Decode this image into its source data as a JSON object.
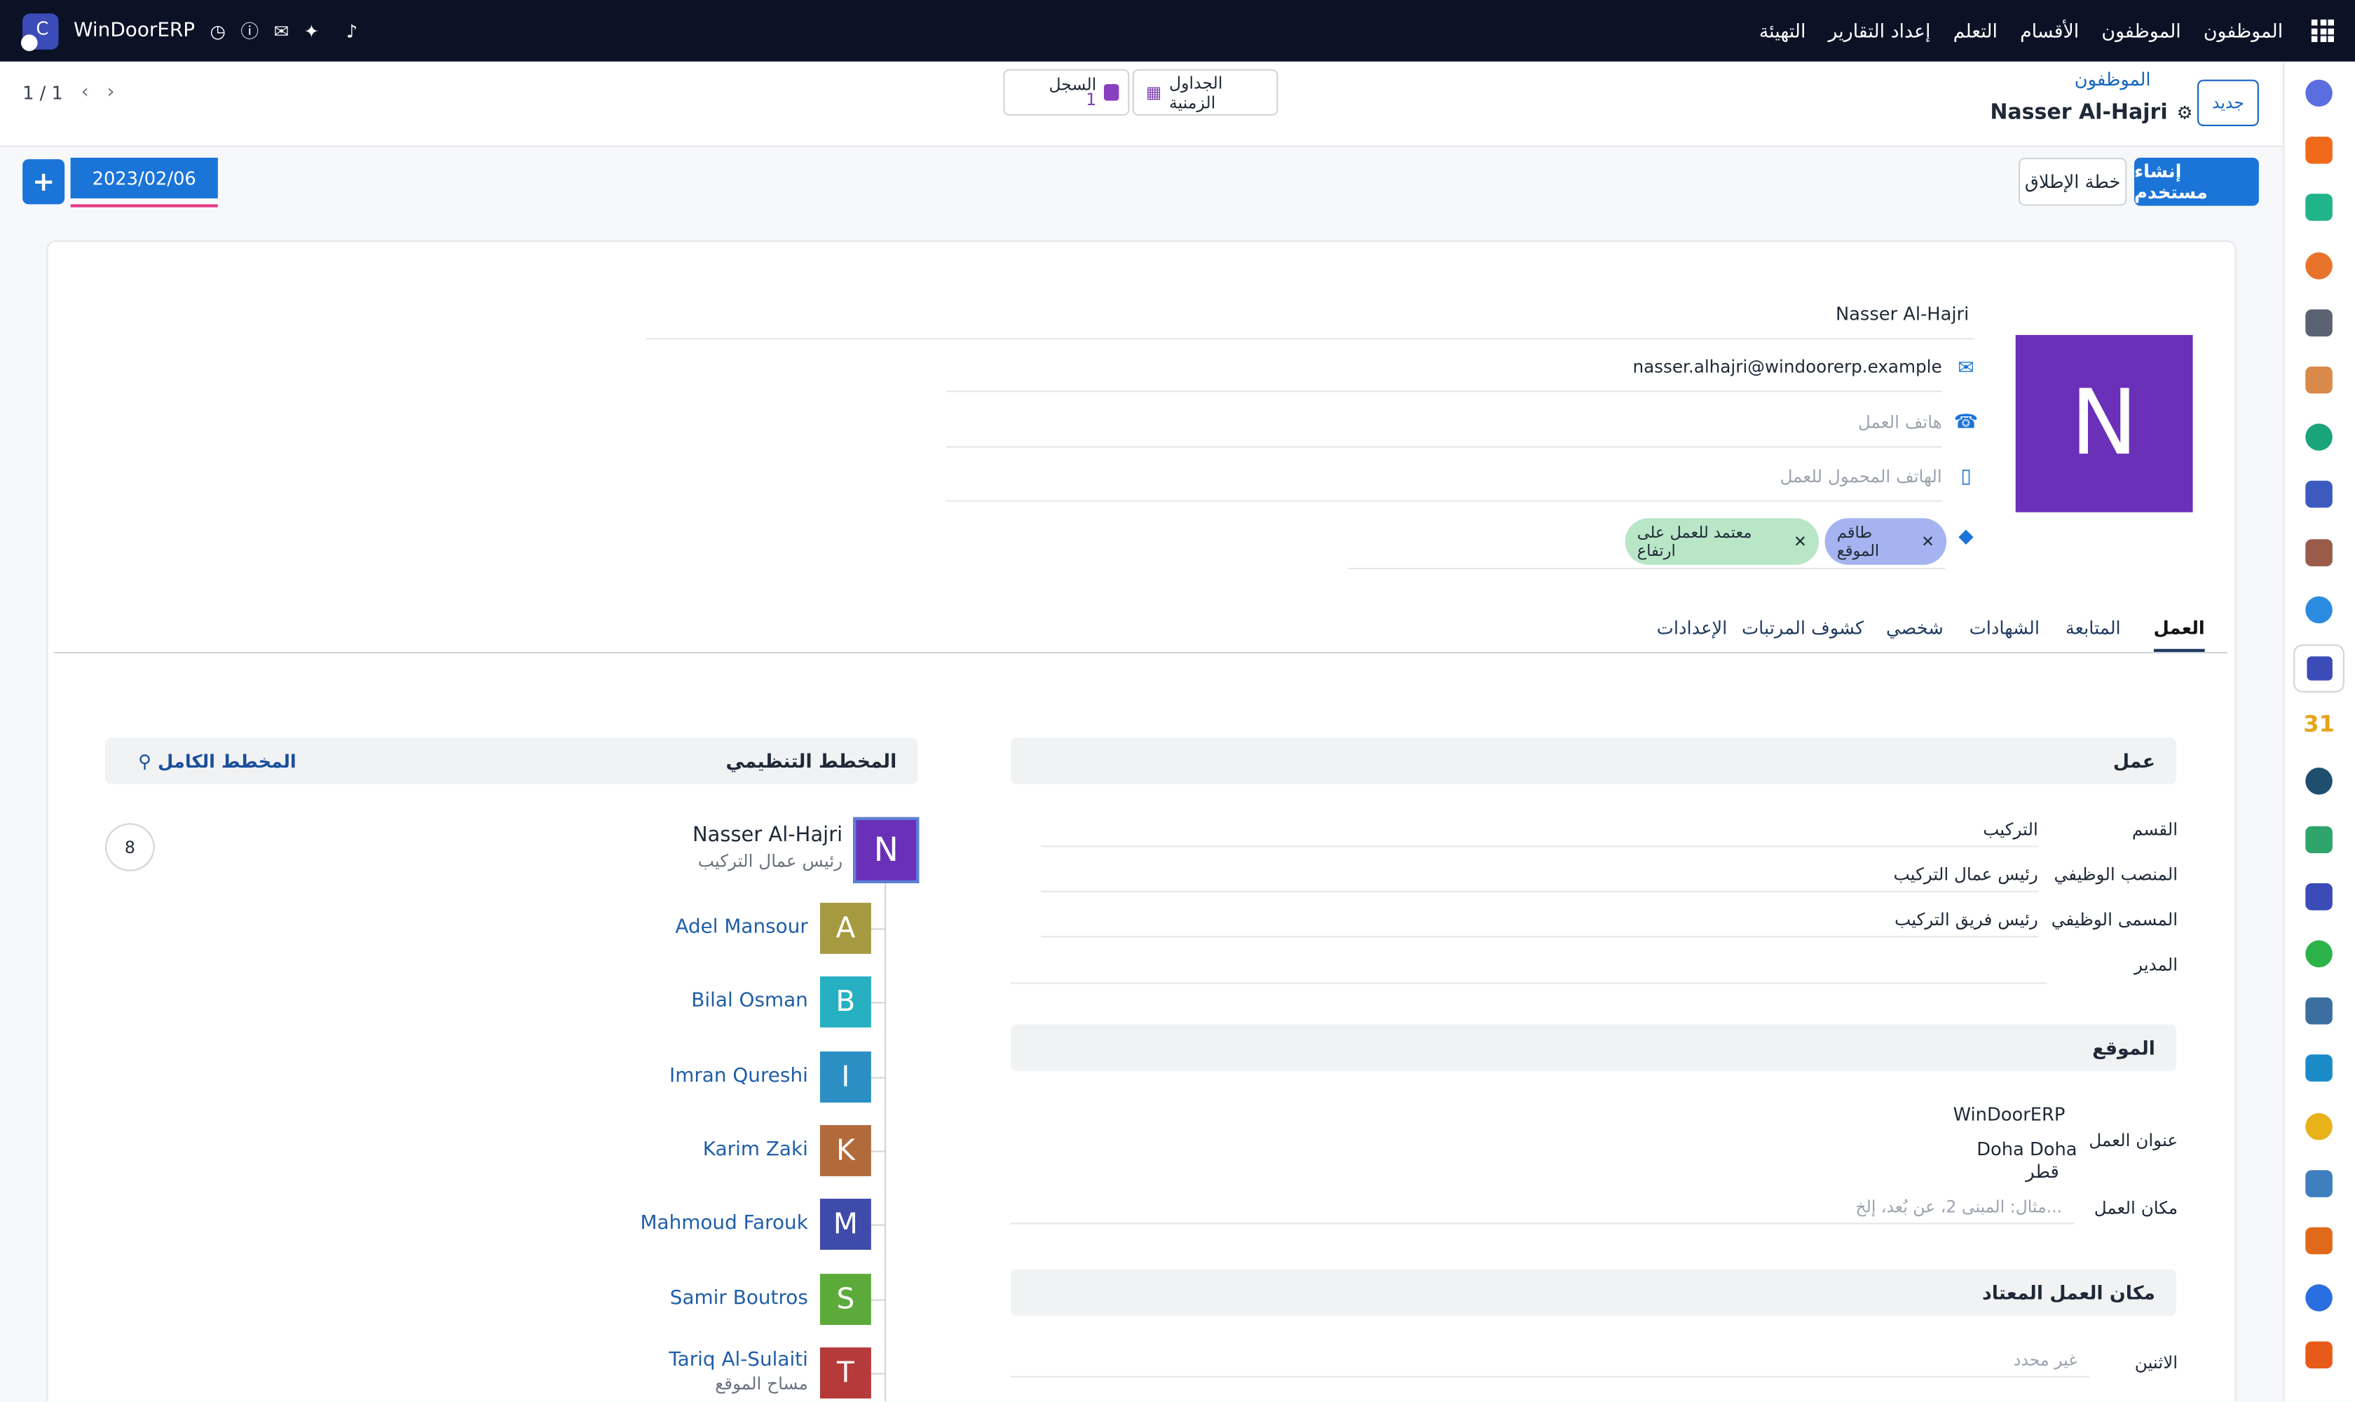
{
  "app": {
    "brand": "WinDoorERP",
    "nav": [
      "الموظفون",
      "الموظفون",
      "الأقسام",
      "التعلم",
      "إعداد التقارير",
      "التهيئة"
    ]
  },
  "control": {
    "pager": "1 / 1",
    "breadcrumb": "الموظفون",
    "record_title": "Nasser Al-Hajri",
    "new_label": "جديد",
    "timesheets_label": "الجداول الزمنية",
    "log_label": "السجل",
    "log_count": "1"
  },
  "actions": {
    "create_user": "إنشاء مستخدم",
    "launch_plan": "خطة الإطلاق",
    "date": "2023/02/06",
    "plus": "+"
  },
  "employee": {
    "initial": "N",
    "name": "Nasser Al-Hajri",
    "email": "nasser.alhajri@windoorerp.example",
    "work_phone_placeholder": "هاتف العمل",
    "mobile_placeholder": "الهاتف المحمول للعمل",
    "tags": [
      "طاقم الموقع",
      "معتمد للعمل على ارتفاع"
    ]
  },
  "tabs": [
    "العمل",
    "المتابعة",
    "الشهادات",
    "شخصي",
    "كشوف المرتبات",
    "الإعدادات"
  ],
  "work": {
    "section_title": "عمل",
    "fields": [
      {
        "label": "القسم",
        "value": "التركيب"
      },
      {
        "label": "المنصب الوظيفي",
        "value": "رئيس عمال التركيب"
      },
      {
        "label": "المسمى الوظيفي",
        "value": "رئيس فريق التركيب"
      },
      {
        "label": "المدير",
        "value": ""
      }
    ]
  },
  "location": {
    "section_title": "الموقع",
    "address_label": "عنوان العمل",
    "address_lines": [
      "WinDoorERP",
      "Doha Doha",
      "قطر"
    ],
    "place_label": "مكان العمل",
    "place_placeholder": "مثال: المبنى 2، عن بُعد، إلخ..."
  },
  "schedule": {
    "section_title": "مكان العمل المعتاد",
    "monday_label": "الاثنين",
    "monday_placeholder": "غير محدد"
  },
  "org": {
    "title": "المخطط التنظيمي",
    "full_chart": "المخطط الكامل",
    "count": "8",
    "head": {
      "initial": "N",
      "name": "Nasser Al-Hajri",
      "role": "رئيس عمال التركيب",
      "color": "#6a30b8"
    },
    "members": [
      {
        "initial": "A",
        "name": "Adel Mansour",
        "color": "#a59a3f"
      },
      {
        "initial": "B",
        "name": "Bilal Osman",
        "color": "#26b0c2"
      },
      {
        "initial": "I",
        "name": "Imran Qureshi",
        "color": "#2b8fc4"
      },
      {
        "initial": "K",
        "name": "Karim Zaki",
        "color": "#b36a3a"
      },
      {
        "initial": "M",
        "name": "Mahmoud Farouk",
        "color": "#3f4baa"
      },
      {
        "initial": "S",
        "name": "Samir Boutros",
        "color": "#5cab3a"
      },
      {
        "initial": "T",
        "name": "Tariq Al-Sulaiti",
        "role": "مساح الموقع",
        "color": "#b63a3a"
      }
    ]
  },
  "sidebar_icons": [
    "m-app-icon",
    "discuss-icon",
    "check-icon",
    "chart-icon",
    "inventory-icon",
    "apps-icon",
    "todo-icon",
    "knowledge-icon",
    "box-icon",
    "invoice-icon",
    "employees-icon",
    "calendar-icon",
    "sign-icon",
    "contacts-icon",
    "dashboard-icon",
    "whatsapp-icon",
    "timer-icon",
    "helpdesk-icon",
    "send-icon",
    "stripe-icon",
    "hex-icon",
    "pie-icon",
    "settings-icon"
  ],
  "calendar_day": "31"
}
